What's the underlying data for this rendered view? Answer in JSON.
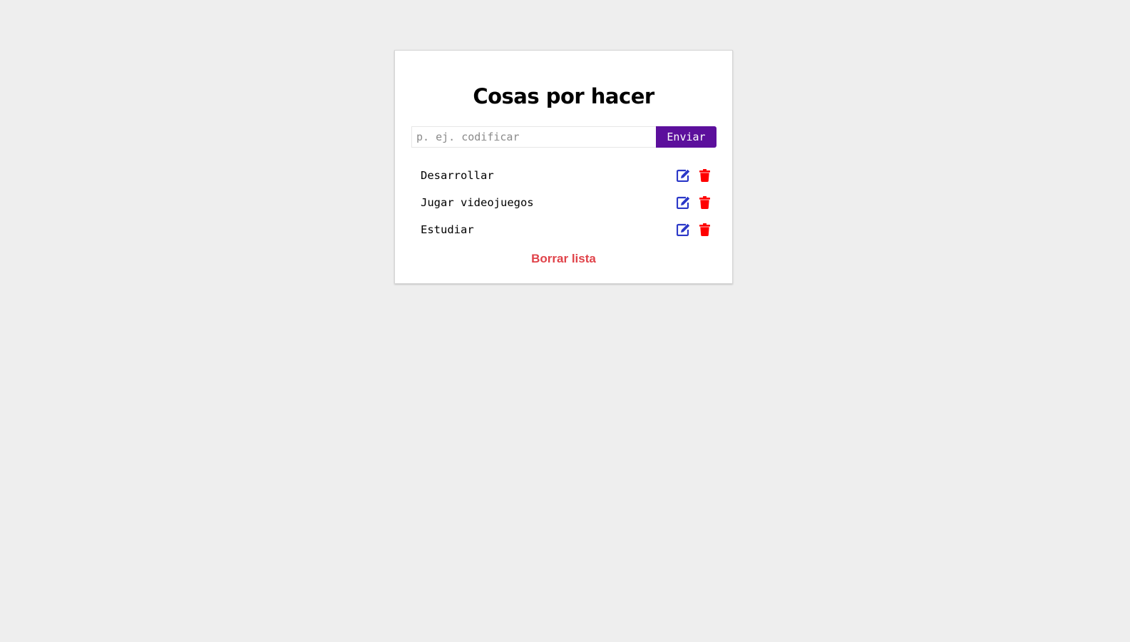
{
  "app": {
    "title": "Cosas por hacer"
  },
  "form": {
    "input_value": "",
    "input_placeholder": "p. ej. codificar",
    "submit_label": "Enviar"
  },
  "todos": [
    {
      "text": "Desarrollar"
    },
    {
      "text": "Jugar videojuegos"
    },
    {
      "text": "Estudiar"
    }
  ],
  "icons": {
    "edit": "edit-icon",
    "delete": "trash-icon"
  },
  "footer": {
    "clear_label": "Borrar lista"
  },
  "colors": {
    "background": "#eeeeee",
    "submit_button": "#5c0f9c",
    "edit_icon": "#2b38c8",
    "delete_icon": "#ff0000",
    "clear_link": "#e0434a"
  }
}
